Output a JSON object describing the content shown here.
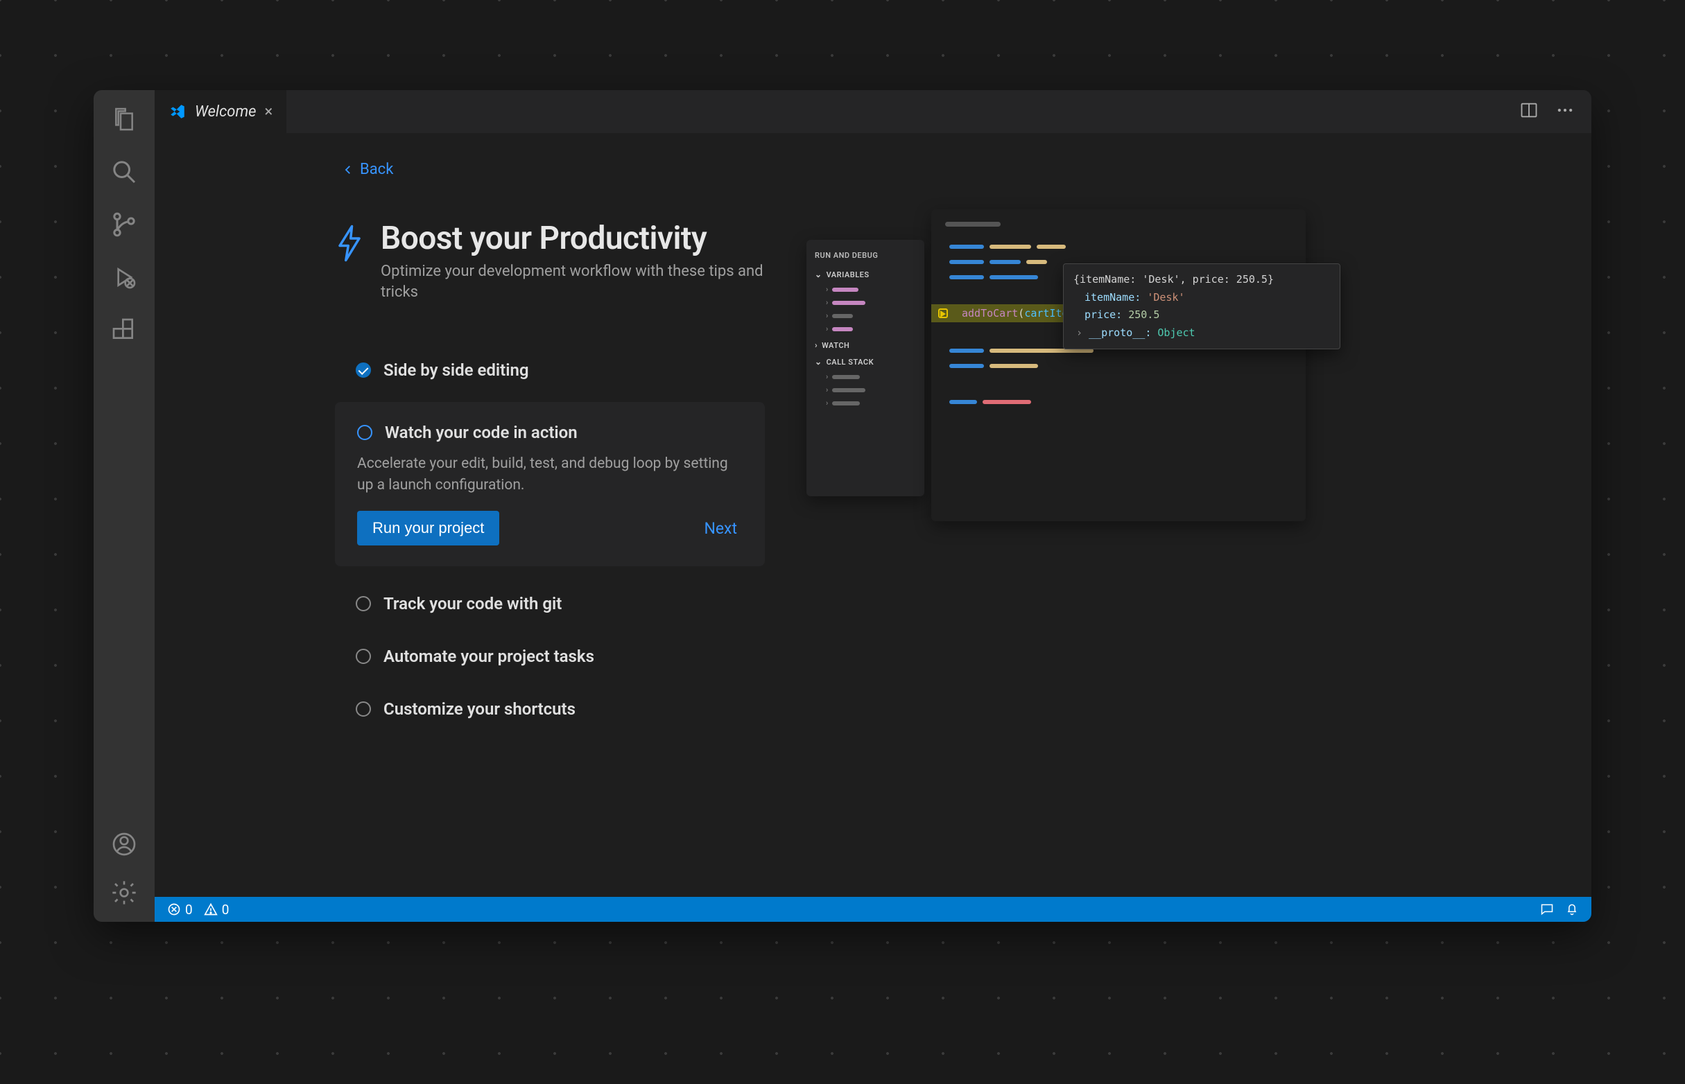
{
  "tab": {
    "title": "Welcome"
  },
  "back_label": "Back",
  "heading": {
    "title": "Boost your Productivity",
    "subtitle": "Optimize your development workflow with these tips and tricks"
  },
  "steps": {
    "done": {
      "label": "Side by side editing"
    },
    "active": {
      "label": "Watch your code in action",
      "desc": "Accelerate your edit, build, test, and debug loop by setting up a launch configuration.",
      "button": "Run your project",
      "next": "Next"
    },
    "others": [
      {
        "label": "Track your code with git"
      },
      {
        "label": "Automate your project tasks"
      },
      {
        "label": "Customize your shortcuts"
      }
    ]
  },
  "debug_panel": {
    "title": "RUN AND DEBUG",
    "sections": {
      "variables": "VARIABLES",
      "watch": "WATCH",
      "callstack": "CALL STACK"
    }
  },
  "tooltip": {
    "line1_full": "{itemName: 'Desk', price: 250.5}",
    "line2_key": "itemName:",
    "line2_val": "'Desk'",
    "line3_key": "price:",
    "line3_val": "250.5",
    "line4_key": "__proto__:",
    "line4_val": "Object"
  },
  "code_line": {
    "fn": "addToCart",
    "open": "(",
    "var": "cartItem",
    "close": ");"
  },
  "status": {
    "errors": "0",
    "warnings": "0"
  }
}
